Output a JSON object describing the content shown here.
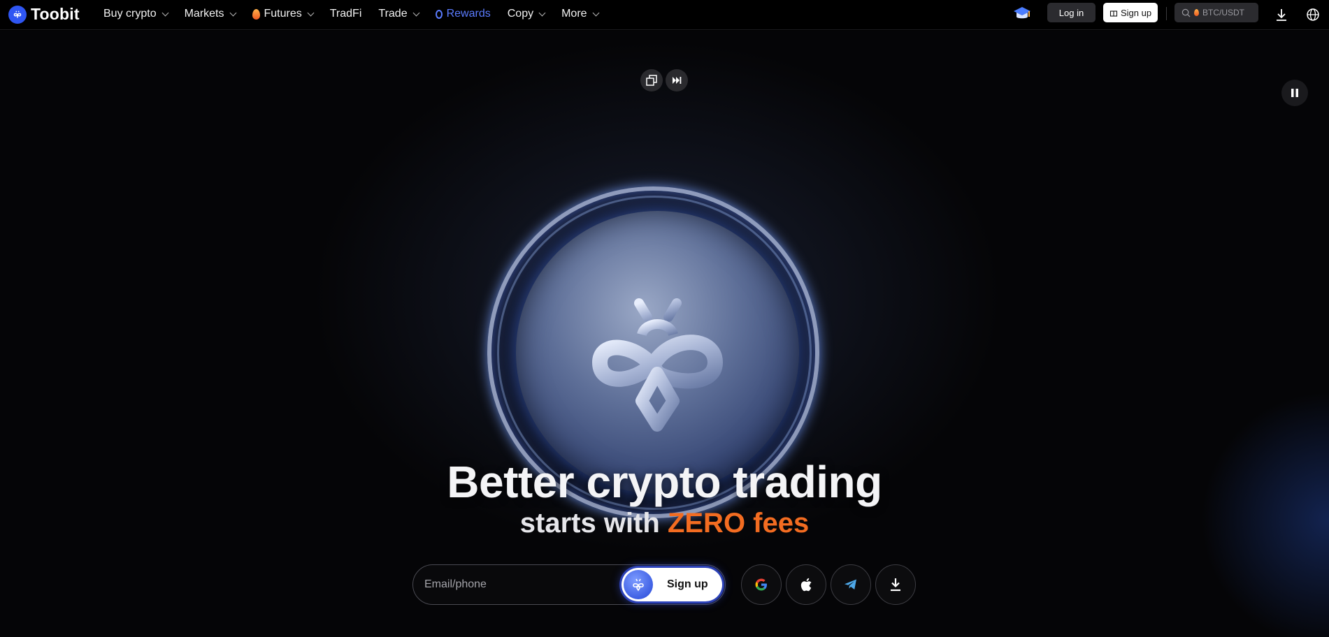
{
  "brand": {
    "name": "Toobit"
  },
  "nav": {
    "items": [
      {
        "label": "Buy crypto",
        "dropdown": true
      },
      {
        "label": "Markets",
        "dropdown": true
      },
      {
        "label": "Futures",
        "dropdown": true,
        "icon": "flame-icon"
      },
      {
        "label": "TradFi",
        "dropdown": false
      },
      {
        "label": "Trade",
        "dropdown": true
      },
      {
        "label": "Rewards",
        "dropdown": false,
        "icon": "medal-icon",
        "color": "#5b7cff"
      },
      {
        "label": "Copy",
        "dropdown": true
      },
      {
        "label": "More",
        "dropdown": true
      }
    ]
  },
  "header": {
    "login_label": "Log in",
    "signup_label": "Sign up",
    "search_placeholder": "BTC/USDT"
  },
  "hero": {
    "headline": "Better crypto trading",
    "subline_prefix": "starts with",
    "subline_accent": "ZERO fees",
    "email_placeholder": "Email/phone",
    "signup_label": "Sign up",
    "social": [
      "google-icon",
      "apple-icon",
      "telegram-icon",
      "download-icon"
    ]
  },
  "colors": {
    "accent": "#f36c21",
    "brand_blue": "#2f56f2",
    "rewards": "#5b7cff"
  }
}
